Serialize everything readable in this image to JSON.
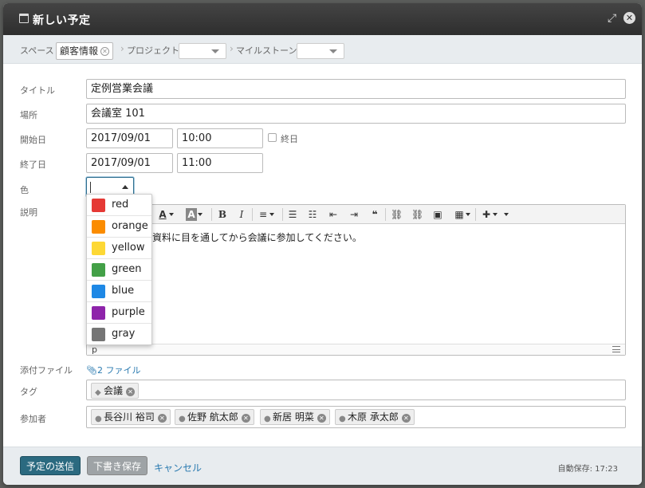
{
  "dialog": {
    "title": "新しい予定"
  },
  "space_bar": {
    "space_label": "スペース",
    "space_value": "顧客情報",
    "project_label": "プロジェクト",
    "project_value": "",
    "milestone_label": "マイルストーン",
    "milestone_value": ""
  },
  "form": {
    "title_label": "タイトル",
    "title_value": "定例営業会議",
    "place_label": "場所",
    "place_value": "会議室 101",
    "start_label": "開始日",
    "start_date": "2017/09/01",
    "start_time": "10:00",
    "allday_label": "終日",
    "end_label": "終了日",
    "end_date": "2017/09/01",
    "end_time": "11:00",
    "color_label": "色",
    "color_value": "",
    "desc_label": "説明",
    "desc_text": "り資料に目を通してから会議に参加してください。",
    "editor_path": "p",
    "attach_label": "添付ファイル",
    "attach_value": "2 ファイル",
    "tag_label": "タグ",
    "participants_label": "参加者"
  },
  "color_options": [
    {
      "name": "red",
      "hex": "#e53935"
    },
    {
      "name": "orange",
      "hex": "#fb8c00"
    },
    {
      "name": "yellow",
      "hex": "#fdd835"
    },
    {
      "name": "green",
      "hex": "#43a047"
    },
    {
      "name": "blue",
      "hex": "#1e88e5"
    },
    {
      "name": "purple",
      "hex": "#8e24aa"
    },
    {
      "name": "gray",
      "hex": "#757575"
    }
  ],
  "tags": [
    "会議"
  ],
  "participants": [
    "長谷川 裕司",
    "佐野 航太郎",
    "新居 明菜",
    "木原 承太郎"
  ],
  "footer": {
    "send_label": "予定の送信",
    "draft_label": "下書き保存",
    "cancel_label": "キャンセル",
    "autosave_text": "自動保存: 17:23"
  },
  "colors": {
    "primary": "#2b6a80",
    "link": "#2a7ab0"
  }
}
